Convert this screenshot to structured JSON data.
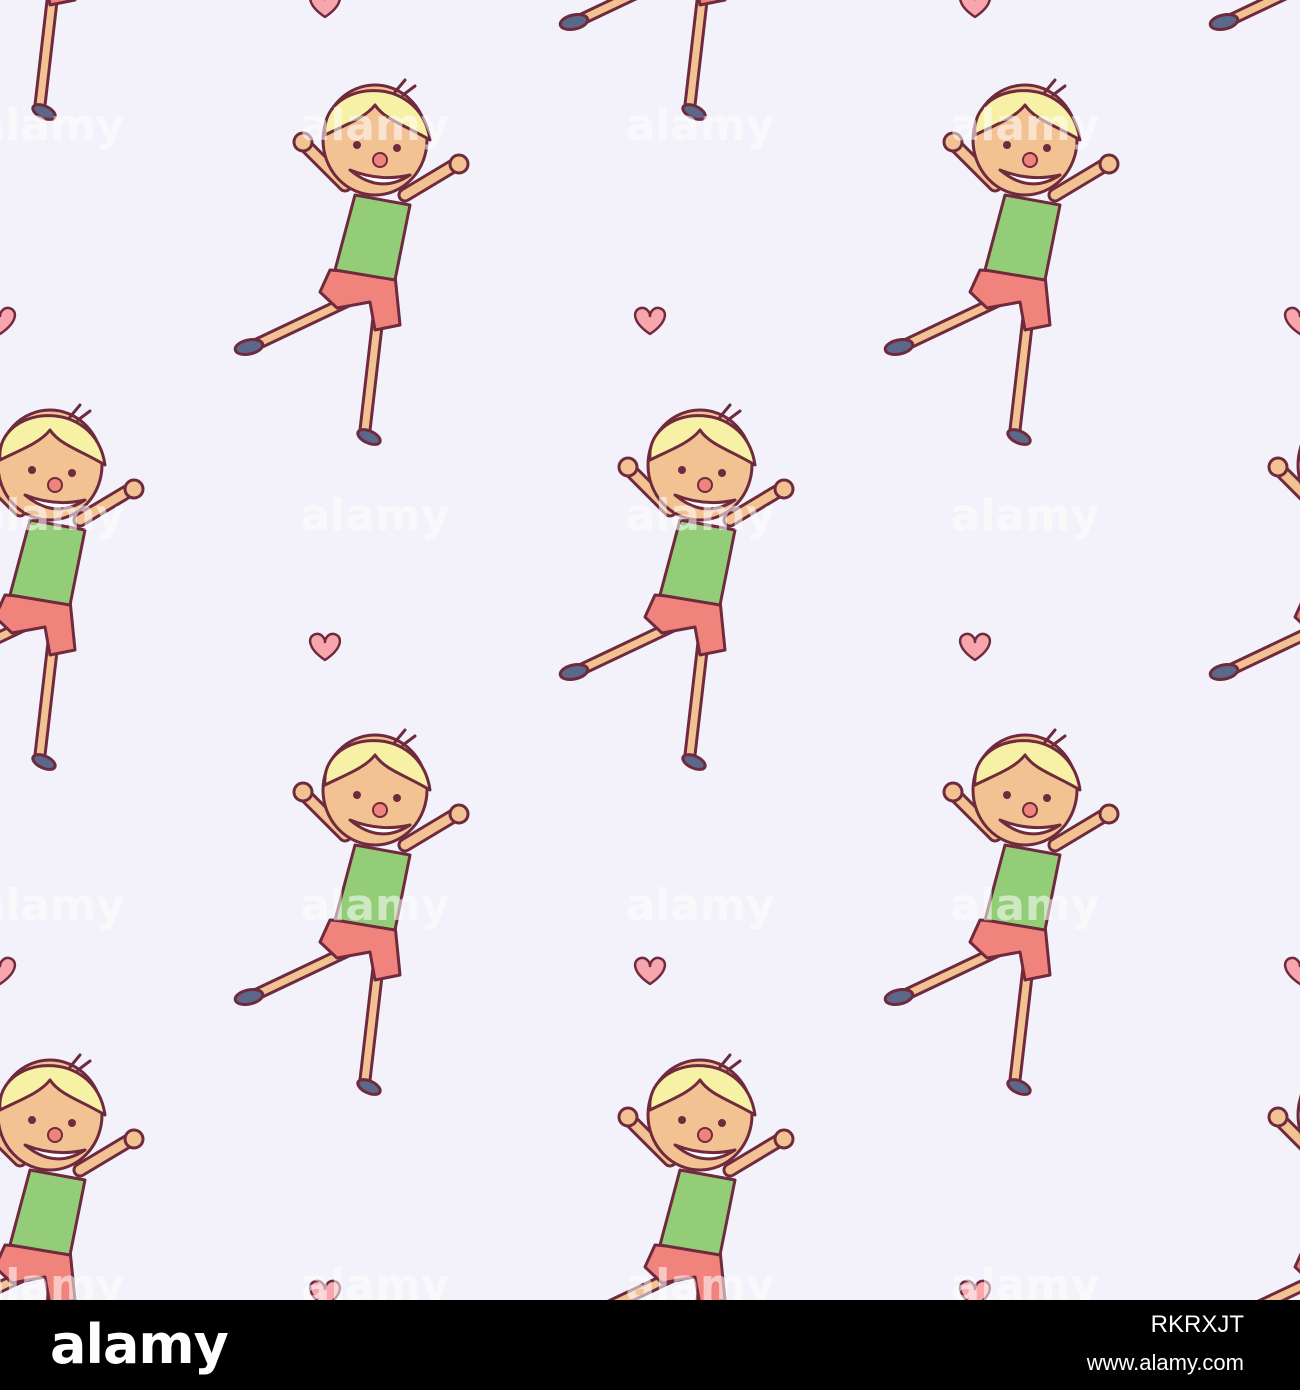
{
  "colors": {
    "background": "#f3f2fa",
    "outline": "#6f2a3e",
    "hair": "#f6f1a4",
    "skin": "#f2c292",
    "shirt": "#94cd78",
    "shorts": "#f0847d",
    "shoes": "#5b6889",
    "heart": "#f7a6ad",
    "watermark": "#ffffff",
    "footer": "#000000"
  },
  "pattern": {
    "motif": "dancing-boy",
    "decoration": "heart-icon",
    "watermark_text": "alamy"
  },
  "footer": {
    "logo_text": "alamy",
    "image_id": "RKRXJT",
    "site_url": "www.alamy.com"
  }
}
